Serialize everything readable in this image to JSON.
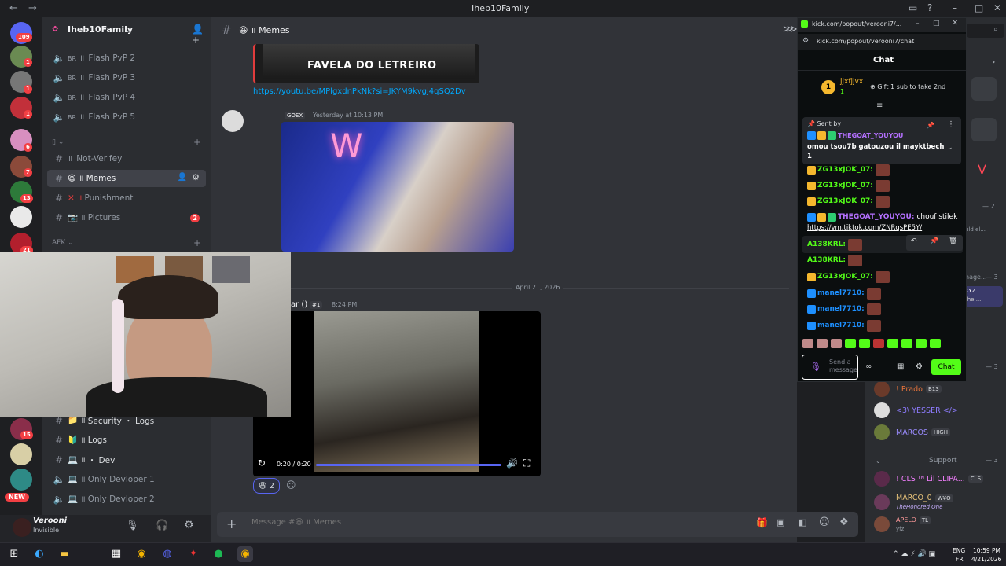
{
  "window": {
    "title": "Iheb10Family"
  },
  "server_badges": {
    "home": "109",
    "s1": "1",
    "s2": "1",
    "s3": "1",
    "s5": "6",
    "s6": "7",
    "s7": "13",
    "s9": "21",
    "s10": "15",
    "new": "NEW"
  },
  "guild": {
    "name": "Iheb10Family"
  },
  "channels": {
    "voice": [
      {
        "prefix": "BR",
        "label": "Flash PvP 2"
      },
      {
        "prefix": "BR",
        "label": "Flash PvP 3"
      },
      {
        "prefix": "BR",
        "label": "Flash PvP 4"
      },
      {
        "prefix": "BR",
        "label": "Flash PvP 5"
      }
    ],
    "text": [
      {
        "label": "Not-Verifey"
      },
      {
        "label": "Memes"
      },
      {
        "label": "Punishment"
      },
      {
        "label": "Pictures",
        "badge": "2"
      }
    ],
    "afk_label": "AFK",
    "bottom": [
      {
        "label": "Security ・ Logs"
      },
      {
        "label": "Logs"
      },
      {
        "label": "・ Dev"
      },
      {
        "label": "Only Devloper 1"
      },
      {
        "label": "Only Devloper 2"
      }
    ]
  },
  "user": {
    "name": "Verooni",
    "status": "Invisible"
  },
  "channel_header": {
    "name": "Memes"
  },
  "messages": {
    "embed_title": "FAVELA DO LETREIRO",
    "link": "https://youtu.be/MPlgxdnPkNk?si=JKYM9kvgj4qSQ2Dv",
    "tag1": "GOEX",
    "timestamp1": "Yesterday at 10:13 PM",
    "date_divider": "April 21, 2026",
    "author2_suffix": "ar",
    "rank2": "#1",
    "timestamp2": "8:24 PM",
    "video_time": "0:20 / 0:20",
    "reaction_count": "2"
  },
  "composer": {
    "placeholder": "Message #😆 ॥ Memes"
  },
  "popout": {
    "url_title": "kick.com/popout/verooni7/...",
    "url": "kick.com/popout/verooni7/chat",
    "header": "Chat",
    "gifter": {
      "name": "jjxfjjvx",
      "count": "1",
      "rank": "1",
      "cta": "Gift 1 sub to take 2nd"
    },
    "pinned": {
      "label": "Sent by",
      "author": "THEGOAT_YOUYOU",
      "text": "omou tsou7b gatouzou il mayktbech 1"
    },
    "messages": [
      {
        "name": "ZG13xJOK_07:",
        "color": "#53fc18"
      },
      {
        "name": "ZG13xJOK_07:",
        "color": "#53fc18"
      },
      {
        "name": "ZG13xJOK_07:",
        "color": "#53fc18"
      },
      {
        "name": "THEGOAT_YOUYOU:",
        "color": "#b470ff",
        "text": "chouf stilek",
        "link": "https://vm.tiktok.com/ZNRqsPE5Y/"
      },
      {
        "name": "A138KRL:",
        "color": "#53fc18"
      },
      {
        "name": "A138KRL:",
        "color": "#53fc18"
      },
      {
        "name": "ZG13xJOK_07:",
        "color": "#53fc18"
      },
      {
        "name": "manel7710:",
        "color": "#1e90ff"
      },
      {
        "name": "manel7710:",
        "color": "#1e90ff"
      },
      {
        "name": "manel7710:",
        "color": "#1e90ff"
      }
    ],
    "send_placeholder": "Send a message",
    "chat_button": "Chat"
  },
  "members": {
    "m_dash2": "— 2",
    "m_dash3": "— 3",
    "m_text1": "uld el...",
    "m_text2": "nage...",
    "m_text3": "— 3",
    "m_kyz": "KYZ",
    "m_kyz2": "the ...",
    "prado": "! Prado",
    "prado_tag": "B13",
    "yesser": "<3\\ YESSER </>",
    "marcos": "MARCOS",
    "marcos_tag": "HIGH",
    "support_section": "Support",
    "support_count": "— 3",
    "cls": "! CLS ᵀᴺ Lil CLIPA...",
    "cls_tag": "CLS",
    "marco": "MARCO_0",
    "marco_tag": "W¥O",
    "marco_sub": "TheHonored One",
    "apelo": "APELO",
    "apelo_tag": "TL",
    "apelo_sub": "yfz"
  },
  "tray": {
    "lang1": "ENG",
    "lang2": "FR",
    "time": "10:59 PM",
    "date": "4/21/2026"
  }
}
